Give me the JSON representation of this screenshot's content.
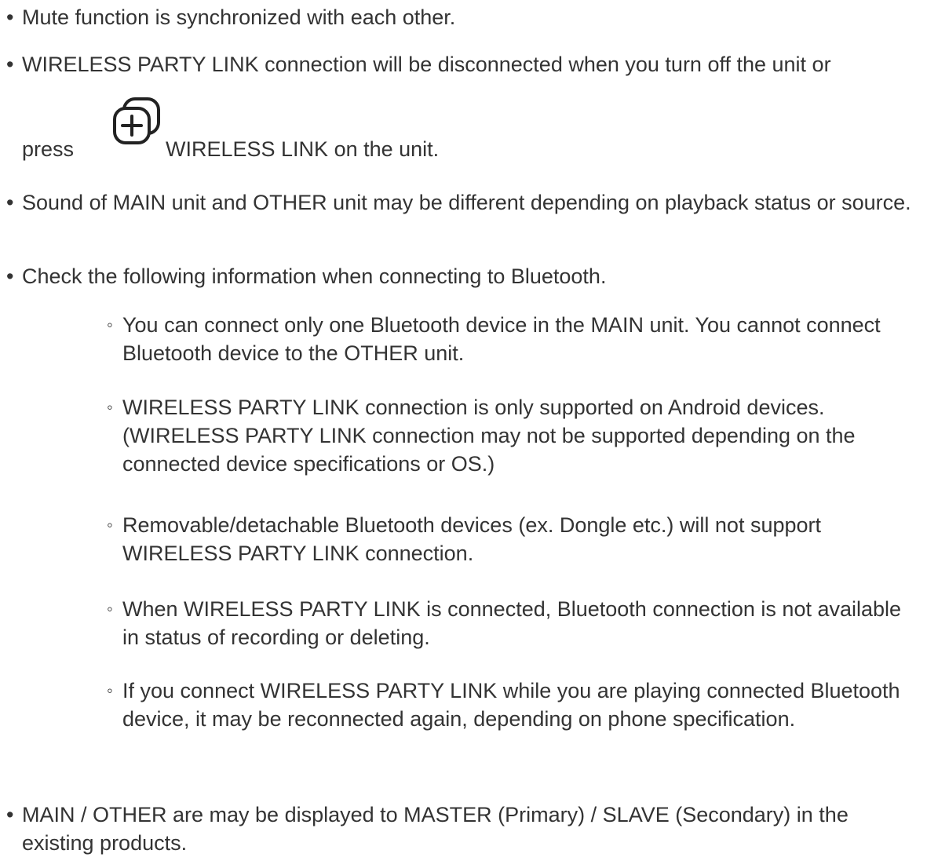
{
  "bullets": {
    "mute": "Mute function is synchronized with each other.",
    "disconnect_line1": "WIRELESS PARTY LINK connection will be disconnected when you turn off the unit or",
    "disconnect_press": "press",
    "disconnect_icon": "wireless-link-icon",
    "disconnect_tail": "WIRELESS LINK on the unit.",
    "sound": "Sound of MAIN unit and OTHER unit may be different depending on playback status or source.",
    "check": "Check the following information when connecting to Bluetooth.",
    "main_other": "MAIN / OTHER are may be displayed to MASTER (Primary) / SLAVE (Secondary) in the existing products."
  },
  "sub_bullets": [
    "You can connect only one Bluetooth device in the MAIN unit. You cannot connect Bluetooth device to the OTHER unit.",
    "WIRELESS PARTY LINK connection is only supported on Android devices. (WIRELESS PARTY LINK connection may not be supported depending on the connected device specifications or OS.)",
    "Removable/detachable Bluetooth devices (ex. Dongle etc.) will not support WIRELESS PARTY LINK connection.",
    "When WIRELESS PARTY LINK is connected, Bluetooth connection is not available in status of recording or deleting.",
    "If you connect WIRELESS PARTY LINK while you are playing connected Bluetooth device, it may be reconnected again, depending on phone specification."
  ],
  "marks": {
    "bullet": "•",
    "sub_bullet": "◦"
  },
  "colors": {
    "text": "#333333",
    "icon": "#222222",
    "background": "#ffffff"
  }
}
